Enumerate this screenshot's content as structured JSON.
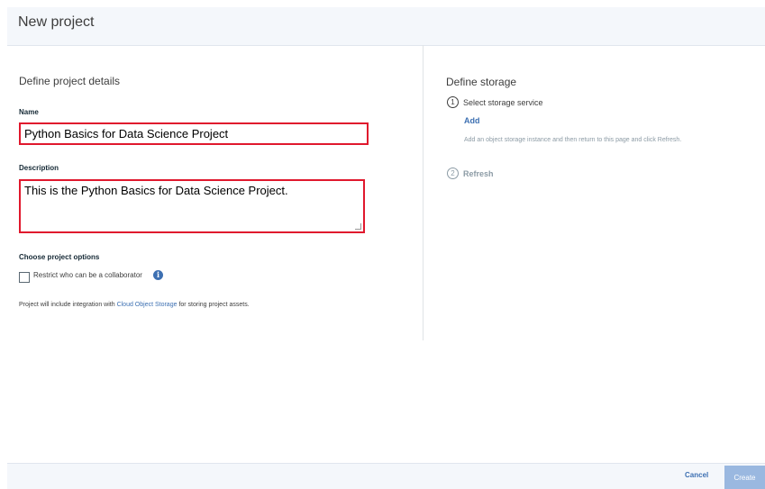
{
  "header": {
    "title": "New project"
  },
  "details": {
    "section_title": "Define project details",
    "name_label": "Name",
    "name_value": "Python Basics for Data Science Project",
    "description_label": "Description",
    "description_value": "This is the Python Basics for Data Science Project.",
    "options_title": "Choose project options",
    "restrict_label": "Restrict who can be a collaborator",
    "restrict_checked": false,
    "integration_prefix": "Project will include integration with ",
    "integration_link": "Cloud Object Storage",
    "integration_suffix": " for storing project assets."
  },
  "storage": {
    "section_title": "Define storage",
    "step1_number": "1",
    "step1_label": "Select storage service",
    "add_link": "Add",
    "helper_text": "Add an object storage instance and then return to this page and click Refresh.",
    "step2_number": "2",
    "step2_label": "Refresh"
  },
  "footer": {
    "cancel_label": "Cancel",
    "create_label": "Create"
  },
  "colors": {
    "accent": "#3d70b2",
    "highlight_border": "#e0182d",
    "header_bg": "#f4f7fb",
    "disabled_button": "#9ab8e0"
  }
}
